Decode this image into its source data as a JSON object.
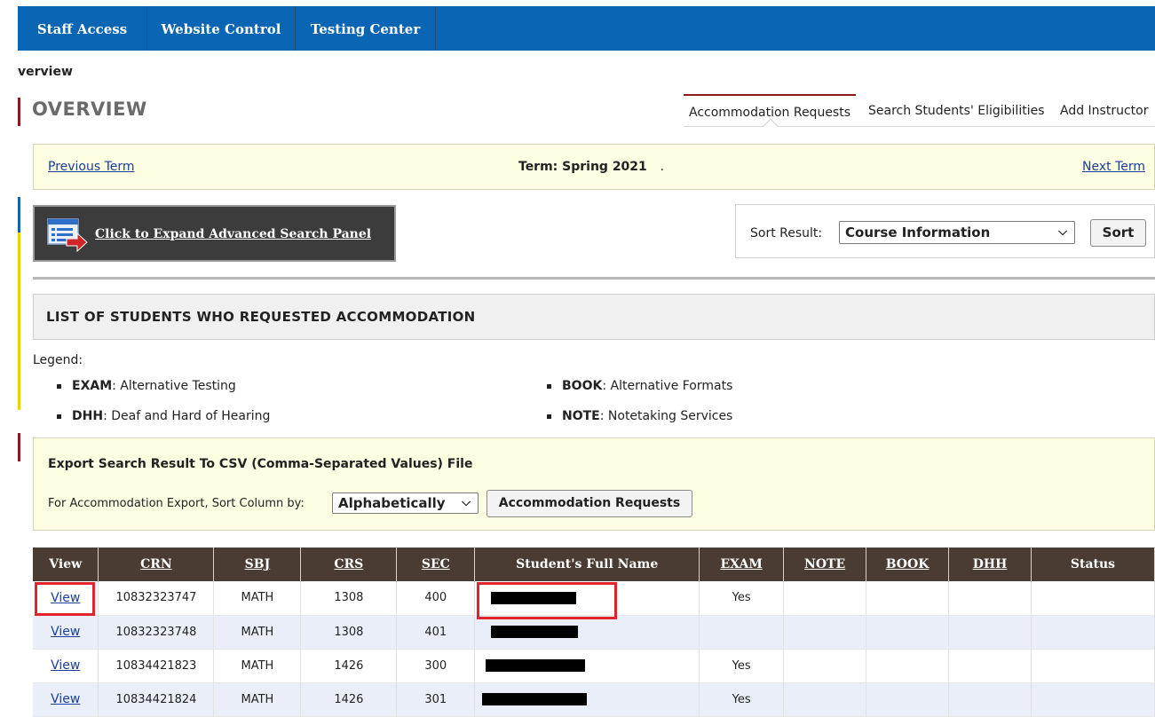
{
  "nav": {
    "tabs": [
      "Staff Access",
      "Website Control",
      "Testing Center"
    ]
  },
  "breadcrumb": "verview",
  "page_title": "OVERVIEW",
  "subtabs": [
    "Accommodation Requests",
    "Search Students' Eligibilities",
    "Add Instructor"
  ],
  "term_bar": {
    "prev": "Previous Term",
    "term": "Term: Spring 2021",
    "term_suffix": ".",
    "next": "Next Term"
  },
  "advanced_search_label": "Click to Expand Advanced Search Panel",
  "sort": {
    "label": "Sort Result:",
    "selected": "Course Information",
    "button": "Sort"
  },
  "list_title": "LIST OF STUDENTS WHO REQUESTED ACCOMMODATION",
  "legend": {
    "title": "Legend:",
    "items": [
      {
        "code": "EXAM",
        "desc": ": Alternative Testing"
      },
      {
        "code": "BOOK",
        "desc": ": Alternative Formats"
      },
      {
        "code": "DHH",
        "desc": ": Deaf and Hard of Hearing"
      },
      {
        "code": "NOTE",
        "desc": ": Notetaking Services"
      }
    ]
  },
  "export": {
    "heading": "Export Search Result To CSV (Comma-Separated Values) File",
    "sort_label": "For Accommodation Export, Sort Column by:",
    "sort_selected": "Alphabetically",
    "button": "Accommodation Requests"
  },
  "table": {
    "columns": [
      "View",
      "CRN",
      "SBJ",
      "CRS",
      "SEC",
      "Student's Full Name",
      "EXAM",
      "NOTE",
      "BOOK",
      "DHH",
      "Status"
    ],
    "rows": [
      {
        "view": "View",
        "crn": "10832323747",
        "sbj": "MATH",
        "crs": "1308",
        "sec": "400",
        "exam": "Yes",
        "note": "",
        "book": "",
        "dhh": "",
        "status": ""
      },
      {
        "view": "View",
        "crn": "10832323748",
        "sbj": "MATH",
        "crs": "1308",
        "sec": "401",
        "exam": "",
        "note": "",
        "book": "",
        "dhh": "",
        "status": ""
      },
      {
        "view": "View",
        "crn": "10834421823",
        "sbj": "MATH",
        "crs": "1426",
        "sec": "300",
        "exam": "Yes",
        "note": "",
        "book": "",
        "dhh": "",
        "status": ""
      },
      {
        "view": "View",
        "crn": "10834421824",
        "sbj": "MATH",
        "crs": "1426",
        "sec": "301",
        "exam": "Yes",
        "note": "",
        "book": "",
        "dhh": "",
        "status": ""
      }
    ]
  },
  "colors": {
    "nav_bg": "#0a65b5",
    "table_header_bg": "#4a3c33",
    "highlight_border": "#e3232c",
    "term_bar_bg": "#fdfde2",
    "link": "#1a3e9c"
  }
}
